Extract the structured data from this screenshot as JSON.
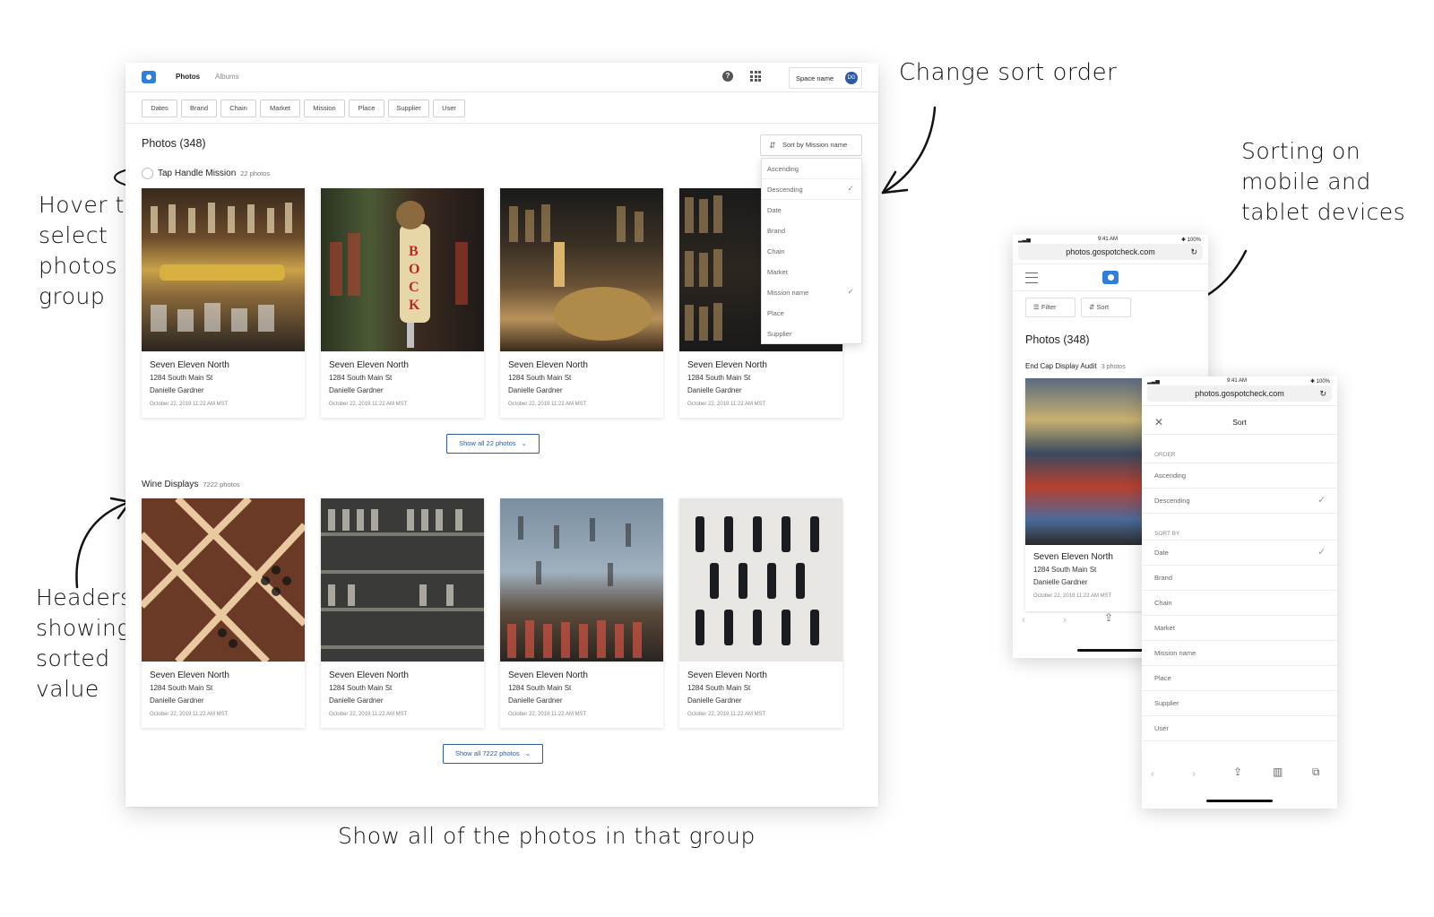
{
  "annotations": {
    "change_sort": "Change sort order",
    "hover": [
      "Hover to",
      "select",
      "photos in",
      "group"
    ],
    "headers": [
      "Headers",
      "showing",
      "sorted",
      "value"
    ],
    "mobile": [
      "Sorting on",
      "mobile and",
      "tablet devices"
    ],
    "show_all": "Show all of the photos in that group"
  },
  "desktop": {
    "nav": {
      "photos": "Photos",
      "albums": "Albums"
    },
    "help": "?",
    "space_name": "Space name",
    "avatar": "DG",
    "filters": [
      "Dates",
      "Brand",
      "Chain",
      "Market",
      "Mission",
      "Place",
      "Supplier",
      "User"
    ],
    "page_title": "Photos (348)",
    "sort_label": "Sort by Mission name",
    "sort_options": [
      "Ascending",
      "Descending",
      "Date",
      "Brand",
      "Chain",
      "Market",
      "Mission name",
      "Place",
      "Supplier"
    ],
    "checkmark": "✓",
    "group1": {
      "name": "Tap Handle Mission",
      "count": "22 photos",
      "show_all": "Show all 22 photos"
    },
    "group2": {
      "name": "Wine Displays",
      "count": "7222 photos",
      "show_all": "Show all 7222 photos"
    },
    "card": {
      "name": "Seven Eleven North",
      "address": "1284 South Main St",
      "user": "Danielle Gardner",
      "date": "October 22, 2019 11:22 AM MST"
    },
    "chevron": "⌄"
  },
  "mobile1": {
    "time": "9:41 AM",
    "battery": "✱ 100%",
    "url": "photos.gospotcheck.com",
    "filter": "Filter",
    "sort": "Sort",
    "title": "Photos (348)",
    "group": "End Cap Display Audit",
    "group_count": "3 photos",
    "card_name": "Seven Eleven North",
    "card_address": "1284 South Main St",
    "card_user": "Danielle Gardner",
    "card_date": "October 22, 2019 11:22 AM MST"
  },
  "mobile2": {
    "time": "9:41 AM",
    "battery": "✱ 100%",
    "url": "photos.gospotcheck.com",
    "title": "Sort",
    "order_header": "ORDER",
    "order": [
      "Ascending",
      "Descending"
    ],
    "sortby_header": "SORT BY",
    "sortby": [
      "Date",
      "Brand",
      "Chain",
      "Market",
      "Mission name",
      "Place",
      "Supplier",
      "User"
    ],
    "checkmark": "✓"
  }
}
